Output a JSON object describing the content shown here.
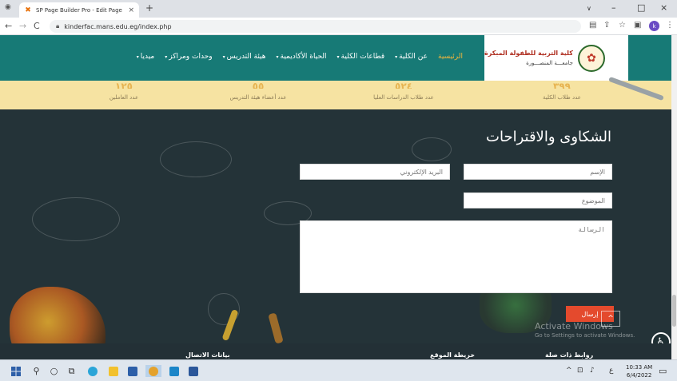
{
  "browser": {
    "tab_title": "SP Page Builder Pro - Edit Page - ",
    "tab_close": "×",
    "new_tab": "+",
    "url": "kinderfac.mans.edu.eg/index.php",
    "back": "←",
    "forward": "→",
    "reload": "C",
    "window_min": "∨",
    "window_dash": "–",
    "window_max": "□",
    "window_close": "×",
    "profile_initial": "k"
  },
  "site": {
    "brand_name": "كلية التربية للطفولة المبكرة",
    "brand_university": "جامعـــة المنصـــورة",
    "menu": [
      {
        "label": "الرئيسية",
        "active": true,
        "has_caret": false
      },
      {
        "label": "عن الكلية",
        "active": false,
        "has_caret": true
      },
      {
        "label": "قطاعات الكلية",
        "active": false,
        "has_caret": true
      },
      {
        "label": "الحياة الأكاديمية",
        "active": false,
        "has_caret": true
      },
      {
        "label": "هيئة التدريس",
        "active": false,
        "has_caret": true
      },
      {
        "label": "وحدات ومراكز",
        "active": false,
        "has_caret": true
      },
      {
        "label": "ميديا",
        "active": false,
        "has_caret": true
      }
    ],
    "stats": [
      {
        "number": "٣٩٩",
        "label": "عدد طلاب الكلية"
      },
      {
        "number": "٥٢٤",
        "label": "عدد طلاب الدراسات العليا"
      },
      {
        "number": "٥٥",
        "label": "عدد أعضاء هيئة التدريس"
      },
      {
        "number": "١٢٥",
        "label": "عدد العاملين"
      }
    ]
  },
  "form": {
    "title": "الشكاوى والاقتراحات",
    "name_placeholder": "الإسم",
    "email_placeholder": "البريد الإلكتروني",
    "subject_placeholder": "الموضوع",
    "message_placeholder": "الرسالة",
    "submit_label": "إرسال",
    "back_to_top": "^"
  },
  "footer": {
    "col1": "روابط ذات صلة",
    "col2": "خريطة الموقع",
    "col3": "بيانات الاتصال"
  },
  "overlay": {
    "activate_title": "Activate Windows",
    "activate_sub": "Go to Settings to activate Windows."
  },
  "taskbar": {
    "time": "10:33 AM",
    "date": "6/4/2022",
    "lang": "ع"
  },
  "colors": {
    "header_teal": "#177a76",
    "accent_orange": "#f4b63b",
    "brand_red": "#b03022",
    "stats_yellow": "#f6e3a2",
    "dark_bg": "#243338",
    "submit_red": "#e44a2d"
  }
}
